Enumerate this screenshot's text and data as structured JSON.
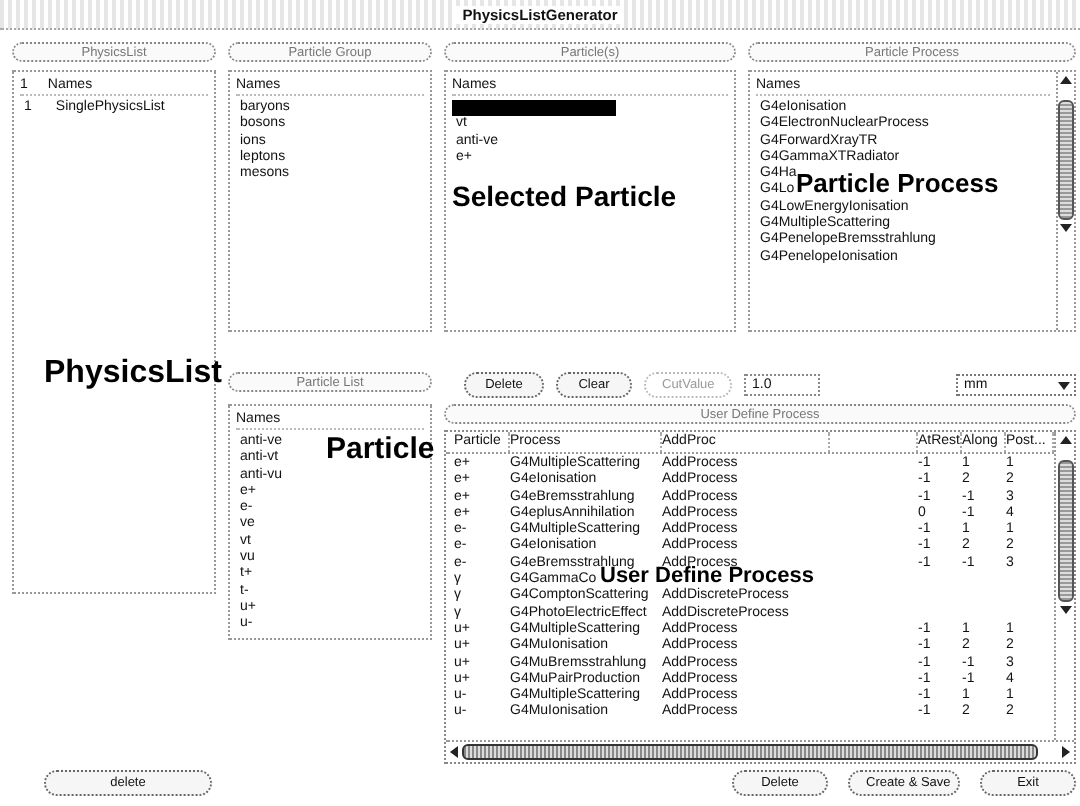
{
  "window": {
    "title": "PhysicsListGenerator"
  },
  "physics_list": {
    "header": "PhysicsList",
    "columns": [
      "1",
      "Names"
    ],
    "rows": [
      {
        "index": "1",
        "name": "SinglePhysicsList"
      }
    ],
    "delete_button": "delete"
  },
  "particle_group": {
    "header": "Particle Group",
    "column": "Names",
    "items": [
      "baryons",
      "bosons",
      "ions",
      "leptons",
      "mesons"
    ]
  },
  "particles": {
    "header": "Particle(s)",
    "column": "Names",
    "items": [
      {
        "selected": true
      },
      {
        "name": "vt",
        "selected": false
      },
      {
        "name": "anti-ve",
        "selected": false
      },
      {
        "name": "e+",
        "selected": false
      }
    ]
  },
  "particle_process": {
    "header": "Particle Process",
    "column": "Names",
    "items": [
      "G4eIonisation",
      "G4ElectronNuclearProcess",
      "G4ForwardXrayTR",
      "G4GammaXTRadiator",
      "G4Ha",
      "G4Lo",
      "G4LowEnergyIonisation",
      "G4MultipleScattering",
      "G4PenelopeBremsstrahlung",
      "G4PenelopeIonisation"
    ]
  },
  "particle_list": {
    "header": "Particle List",
    "column": "Names",
    "items": [
      "anti-ve",
      "anti-vt",
      "anti-vu",
      "e+",
      "e-",
      "ve",
      "vt",
      "vu",
      "t+",
      "t-",
      "u+",
      "u-"
    ]
  },
  "controls": {
    "delete": "Delete",
    "clear": "Clear",
    "cut_value": {
      "label": "CutValue",
      "disabled": true
    },
    "cut_value_field": "1.0",
    "unit": "mm"
  },
  "user_process": {
    "header": "User Define Process",
    "columns": [
      "Particle",
      "Process",
      "AddProc",
      "AtRest",
      "Along",
      "Post..."
    ],
    "rows": [
      [
        "e+",
        "G4MultipleScattering",
        "AddProcess",
        "-1",
        "1",
        "1"
      ],
      [
        "e+",
        "G4eIonisation",
        "AddProcess",
        "-1",
        "2",
        "2"
      ],
      [
        "e+",
        "G4eBremsstrahlung",
        "AddProcess",
        "-1",
        "-1",
        "3"
      ],
      [
        "e+",
        "G4eplusAnnihilation",
        "AddProcess",
        "0",
        "-1",
        "4"
      ],
      [
        "e-",
        "G4MultipleScattering",
        "AddProcess",
        "-1",
        "1",
        "1"
      ],
      [
        "e-",
        "G4eIonisation",
        "AddProcess",
        "-1",
        "2",
        "2"
      ],
      [
        "e-",
        "G4eBremsstrahlung",
        "AddProcess",
        "-1",
        "-1",
        "3"
      ],
      [
        "γ",
        "G4GammaCo"
      ],
      [
        "γ",
        "G4ComptonScattering",
        "AddDiscreteProcess"
      ],
      [
        "γ",
        "G4PhotoElectricEffect",
        "AddDiscreteProcess"
      ],
      [
        "u+",
        "G4MultipleScattering",
        "AddProcess",
        "-1",
        "1",
        "1"
      ],
      [
        "u+",
        "G4MuIonisation",
        "AddProcess",
        "-1",
        "2",
        "2"
      ],
      [
        "u+",
        "G4MuBremsstrahlung",
        "AddProcess",
        "-1",
        "-1",
        "3"
      ],
      [
        "u+",
        "G4MuPairProduction",
        "AddProcess",
        "-1",
        "-1",
        "4"
      ],
      [
        "u-",
        "G4MultipleScattering",
        "AddProcess",
        "-1",
        "1",
        "1"
      ],
      [
        "u-",
        "G4MuIonisation",
        "AddProcess",
        "-1",
        "2",
        "2"
      ]
    ]
  },
  "footer_buttons": [
    "Delete",
    "Create & Save",
    "Exit"
  ],
  "annotations": [
    {
      "kind": "selected",
      "text": "Selected Particle"
    },
    {
      "kind": "process",
      "text": "Particle Process"
    },
    {
      "kind": "physics",
      "text": "PhysicsList"
    },
    {
      "kind": "particle",
      "text": "Particle"
    },
    {
      "kind": "user",
      "text": "User Define Process"
    }
  ]
}
